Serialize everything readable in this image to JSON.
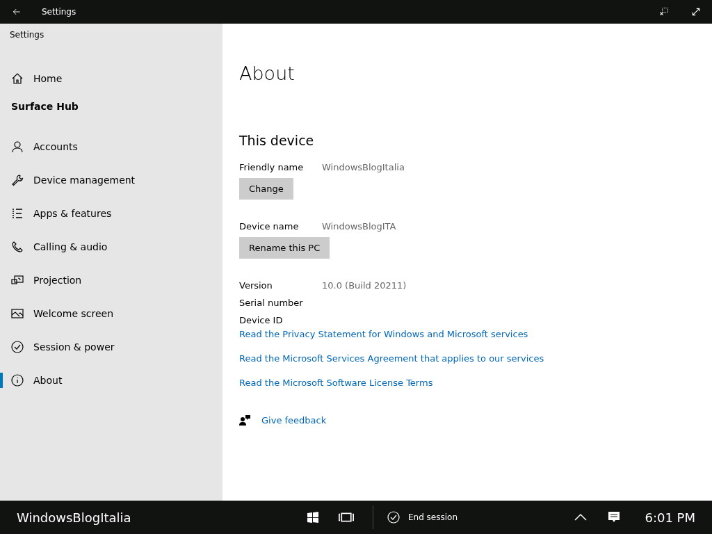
{
  "title_bar": {
    "title": "Settings"
  },
  "sidebar": {
    "header": "Settings",
    "home": "Home",
    "section": "Surface Hub",
    "items": [
      {
        "label": "Accounts",
        "selected": false
      },
      {
        "label": "Device management",
        "selected": false
      },
      {
        "label": "Apps & features",
        "selected": false
      },
      {
        "label": "Calling & audio",
        "selected": false
      },
      {
        "label": "Projection",
        "selected": false
      },
      {
        "label": "Welcome screen",
        "selected": false
      },
      {
        "label": "Session & power",
        "selected": false
      },
      {
        "label": "About",
        "selected": true
      }
    ]
  },
  "page": {
    "title": "About",
    "section": "This device",
    "friendly_name": {
      "label": "Friendly name",
      "value": "WindowsBlogItalia",
      "button": "Change"
    },
    "device_name": {
      "label": "Device name",
      "value": "WindowsBlogITA",
      "button": "Rename this PC"
    },
    "info": [
      {
        "label": "Version",
        "value": "10.0 (Build 20211)"
      },
      {
        "label": "Serial number"
      },
      {
        "label": "Device ID"
      }
    ],
    "links": [
      "Read the Privacy Statement for Windows and Microsoft services",
      "Read the Microsoft Services Agreement that applies to our services",
      "Read the Microsoft Software License Terms"
    ],
    "feedback": "Give feedback"
  },
  "taskbar": {
    "device": "WindowsBlogItalia",
    "end_session": "End session",
    "time": "6:01 PM"
  }
}
